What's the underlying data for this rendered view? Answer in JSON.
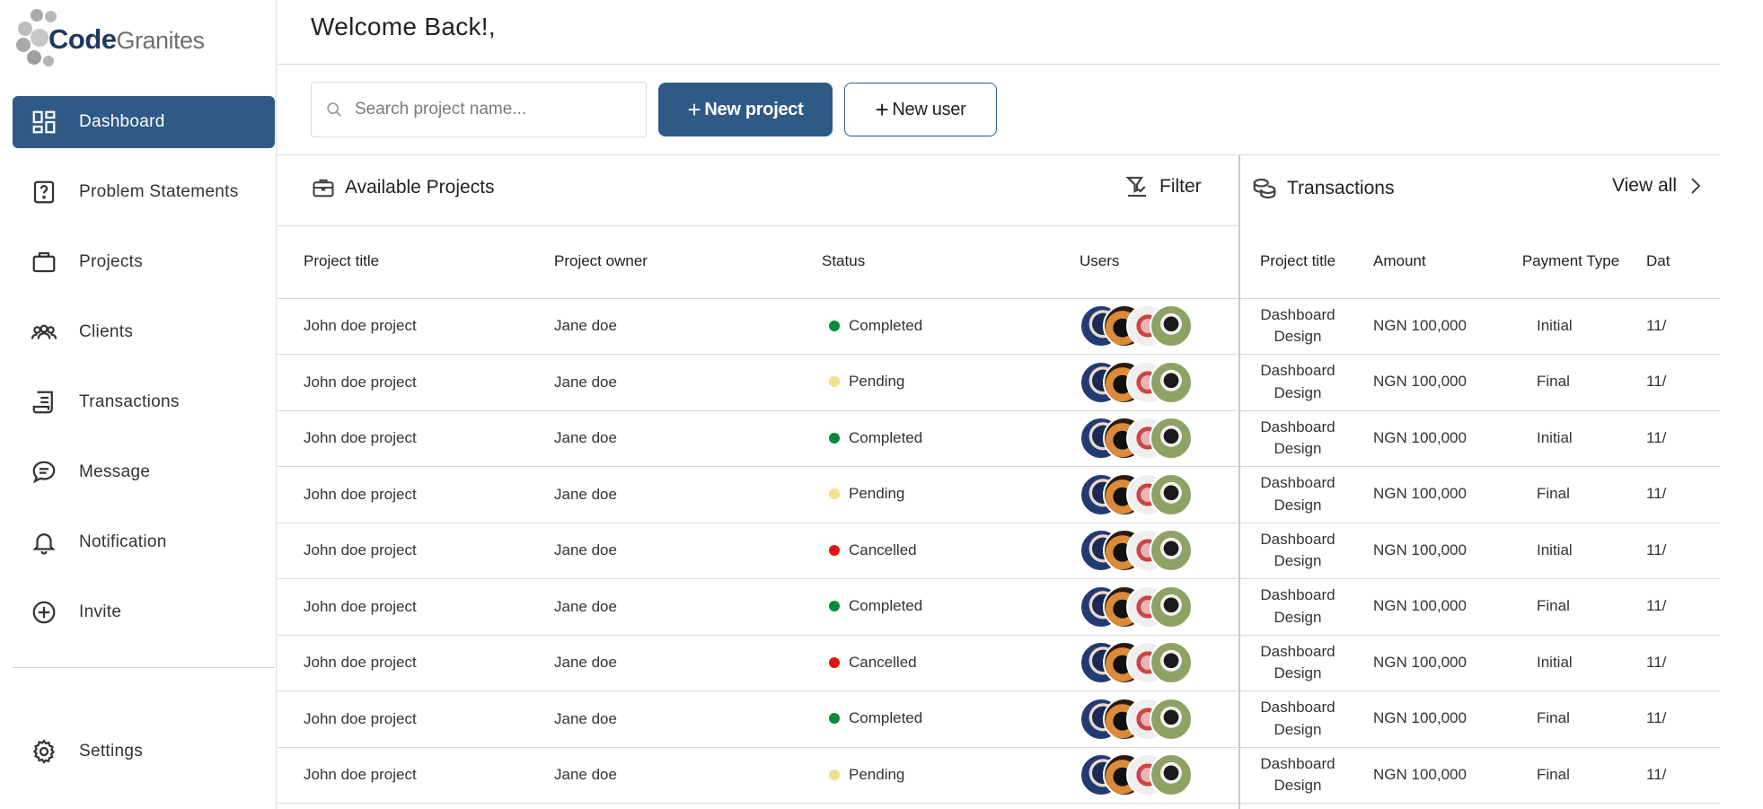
{
  "logo": {
    "part1": "Code",
    "part2": "Granites"
  },
  "nav": [
    {
      "label": "Dashboard",
      "icon": "dashboard-icon",
      "active": true
    },
    {
      "label": "Problem Statements",
      "icon": "question-icon"
    },
    {
      "label": "Projects",
      "icon": "briefcase-icon"
    },
    {
      "label": "Clients",
      "icon": "users-icon"
    },
    {
      "label": "Transactions",
      "icon": "receipt-icon"
    },
    {
      "label": "Message",
      "icon": "chat-icon"
    },
    {
      "label": "Notification",
      "icon": "bell-icon"
    },
    {
      "label": "Invite",
      "icon": "plus-circle-icon"
    }
  ],
  "settings": {
    "label": "Settings",
    "icon": "gear-icon"
  },
  "header": {
    "welcome": "Welcome Back!,"
  },
  "search": {
    "placeholder": "Search project name..."
  },
  "actions": {
    "new_project": "New project",
    "new_user": "New user",
    "plus": "+"
  },
  "projects": {
    "title": "Available Projects",
    "filter_label": "Filter",
    "columns": [
      "Project title",
      "Project owner",
      "Status",
      "Users"
    ],
    "rows": [
      {
        "title": "John doe project",
        "owner": "Jane doe",
        "status": "Completed"
      },
      {
        "title": "John doe project",
        "owner": "Jane doe",
        "status": "Pending"
      },
      {
        "title": "John doe project",
        "owner": "Jane doe",
        "status": "Completed"
      },
      {
        "title": "John doe project",
        "owner": "Jane doe",
        "status": "Pending"
      },
      {
        "title": "John doe project",
        "owner": "Jane doe",
        "status": "Cancelled"
      },
      {
        "title": "John doe project",
        "owner": "Jane doe",
        "status": "Completed"
      },
      {
        "title": "John doe project",
        "owner": "Jane doe",
        "status": "Cancelled"
      },
      {
        "title": "John doe project",
        "owner": "Jane doe",
        "status": "Completed"
      },
      {
        "title": "John doe project",
        "owner": "Jane doe",
        "status": "Pending"
      }
    ],
    "status_colors": {
      "Completed": "#0a8a3a",
      "Pending": "#f1e08e",
      "Cancelled": "#e01414"
    }
  },
  "transactions": {
    "title": "Transactions",
    "view_all": "View all",
    "columns": [
      "Project title",
      "Amount",
      "Payment Type",
      "Dat"
    ],
    "rows": [
      {
        "title": "Dashboard Design",
        "amount": "NGN 100,000",
        "type": "Initial",
        "date": "11/"
      },
      {
        "title": "Dashboard Design",
        "amount": "NGN 100,000",
        "type": "Final",
        "date": "11/"
      },
      {
        "title": "Dashboard Design",
        "amount": "NGN 100,000",
        "type": "Initial",
        "date": "11/"
      },
      {
        "title": "Dashboard Design",
        "amount": "NGN 100,000",
        "type": "Final",
        "date": "11/"
      },
      {
        "title": "Dashboard Design",
        "amount": "NGN 100,000",
        "type": "Initial",
        "date": "11/"
      },
      {
        "title": "Dashboard Design",
        "amount": "NGN 100,000",
        "type": "Final",
        "date": "11/"
      },
      {
        "title": "Dashboard Design",
        "amount": "NGN 100,000",
        "type": "Initial",
        "date": "11/"
      },
      {
        "title": "Dashboard Design",
        "amount": "NGN 100,000",
        "type": "Final",
        "date": "11/"
      },
      {
        "title": "Dashboard Design",
        "amount": "NGN 100,000",
        "type": "Final",
        "date": "11/"
      }
    ]
  },
  "colors": {
    "accent": "#2f5a85",
    "border": "#d9d9d9"
  }
}
